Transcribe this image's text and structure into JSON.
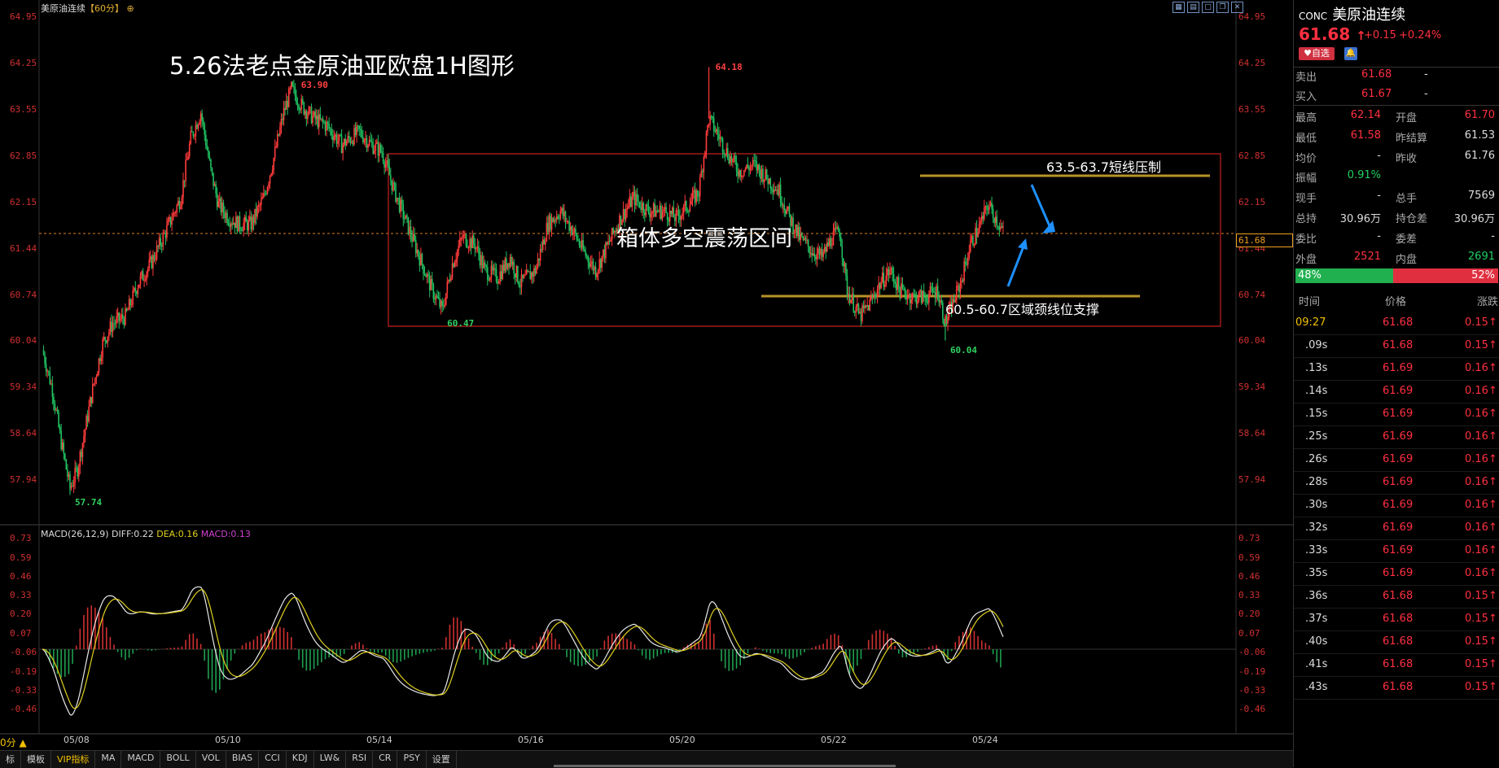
{
  "chart": {
    "symbol_title": "美原油连续",
    "period": "【60分】",
    "plus_icon": "⊕",
    "toolbar_icons": [
      "grid-icon",
      "layout-icon",
      "window-icon",
      "restore-icon",
      "close-icon"
    ],
    "annotation_title": "5.26法老点金原油亚欧盘1H图形",
    "annotation_box": "箱体多空震荡区间",
    "annotation_resist": "63.5-63.7短线压制",
    "annotation_support": "60.5-60.7区域颈线位支撑",
    "y_axis_labels": [
      "64.95",
      "64.25",
      "63.55",
      "62.85",
      "62.15",
      "61.44",
      "60.74",
      "60.04",
      "59.34",
      "58.64",
      "57.94"
    ],
    "current_price_tag": "61.68",
    "price_marks": [
      {
        "label": "63.90",
        "color": "red"
      },
      {
        "label": "64.18",
        "color": "red"
      },
      {
        "label": "60.47",
        "color": "green"
      },
      {
        "label": "60.04",
        "color": "green"
      },
      {
        "label": "57.74",
        "color": "green"
      }
    ],
    "date_labels": [
      "05/08",
      "05/10",
      "05/14",
      "05/16",
      "05/20",
      "05/22",
      "05/24"
    ],
    "macd": {
      "title": "MACD(26,12,9)",
      "diff_label": "DIFF:0.22",
      "dea_label": "DEA:0.16",
      "macd_label": "MACD:0.13",
      "y_axis_labels": [
        "0.73",
        "0.59",
        "0.46",
        "0.33",
        "0.20",
        "0.07",
        "-0.06",
        "-0.19",
        "-0.33",
        "-0.46"
      ]
    },
    "cycle_label": "0分 ▲",
    "bottom_tabs": [
      "标",
      "模板",
      "VIP指标",
      "MA",
      "MACD",
      "BOLL",
      "VOL",
      "BIAS",
      "CCI",
      "KDJ",
      "LW&",
      "RSI",
      "CR",
      "PSY",
      "设置"
    ],
    "colors": {
      "up": "#ff3b3b",
      "down": "#20c060",
      "box": "#d02020",
      "gold": "#c9a030",
      "arrow": "#1e90ff"
    }
  },
  "panel": {
    "code": "CONC",
    "name": "美原油连续",
    "price": "61.68",
    "arrow": "↑",
    "change": "+0.15",
    "change_pct": "+0.24%",
    "fav_label": "自选",
    "bell_icon": "bell-icon",
    "sell_label": "卖出",
    "sell_price": "61.68",
    "sell_vol": "-",
    "buy_label": "买入",
    "buy_price": "61.67",
    "buy_vol": "-",
    "stats": [
      {
        "l1": "最高",
        "v1": "62.14",
        "c1": "red",
        "l2": "开盘",
        "v2": "61.70",
        "c2": "red"
      },
      {
        "l1": "最低",
        "v1": "61.58",
        "c1": "red",
        "l2": "昨结算",
        "v2": "61.53",
        "c2": "white"
      },
      {
        "l1": "均价",
        "v1": "-",
        "c1": "white",
        "l2": "昨收",
        "v2": "61.76",
        "c2": "white"
      },
      {
        "l1": "振幅",
        "v1": "0.91%",
        "c1": "green",
        "l2": "",
        "v2": "",
        "c2": "white"
      },
      {
        "l1": "现手",
        "v1": "-",
        "c1": "white",
        "l2": "总手",
        "v2": "7569",
        "c2": "white"
      },
      {
        "l1": "总持",
        "v1": "30.96万",
        "c1": "white",
        "l2": "持仓差",
        "v2": "30.96万",
        "c2": "white"
      },
      {
        "l1": "委比",
        "v1": "-",
        "c1": "white",
        "l2": "委差",
        "v2": "-",
        "c2": "white"
      },
      {
        "l1": "外盘",
        "v1": "2521",
        "c1": "red",
        "l2": "内盘",
        "v2": "2691",
        "c2": "green"
      }
    ],
    "buy_ratio": "48%",
    "sell_ratio": "52%",
    "buy_ratio_value": 48,
    "trade_headers": [
      "时间",
      "价格",
      "涨跌"
    ],
    "trades": [
      {
        "t": "09:27",
        "p": "61.68",
        "c": "0.15"
      },
      {
        "t": ".09s",
        "p": "61.68",
        "c": "0.15"
      },
      {
        "t": ".13s",
        "p": "61.69",
        "c": "0.16"
      },
      {
        "t": ".14s",
        "p": "61.69",
        "c": "0.16"
      },
      {
        "t": ".15s",
        "p": "61.69",
        "c": "0.16"
      },
      {
        "t": ".25s",
        "p": "61.69",
        "c": "0.16"
      },
      {
        "t": ".26s",
        "p": "61.69",
        "c": "0.16"
      },
      {
        "t": ".28s",
        "p": "61.69",
        "c": "0.16"
      },
      {
        "t": ".30s",
        "p": "61.69",
        "c": "0.16"
      },
      {
        "t": ".32s",
        "p": "61.69",
        "c": "0.16"
      },
      {
        "t": ".33s",
        "p": "61.69",
        "c": "0.16"
      },
      {
        "t": ".35s",
        "p": "61.69",
        "c": "0.16"
      },
      {
        "t": ".36s",
        "p": "61.68",
        "c": "0.15"
      },
      {
        "t": ".37s",
        "p": "61.68",
        "c": "0.15"
      },
      {
        "t": ".40s",
        "p": "61.68",
        "c": "0.15"
      },
      {
        "t": ".41s",
        "p": "61.68",
        "c": "0.15"
      },
      {
        "t": ".43s",
        "p": "61.68",
        "c": "0.15"
      }
    ]
  }
}
